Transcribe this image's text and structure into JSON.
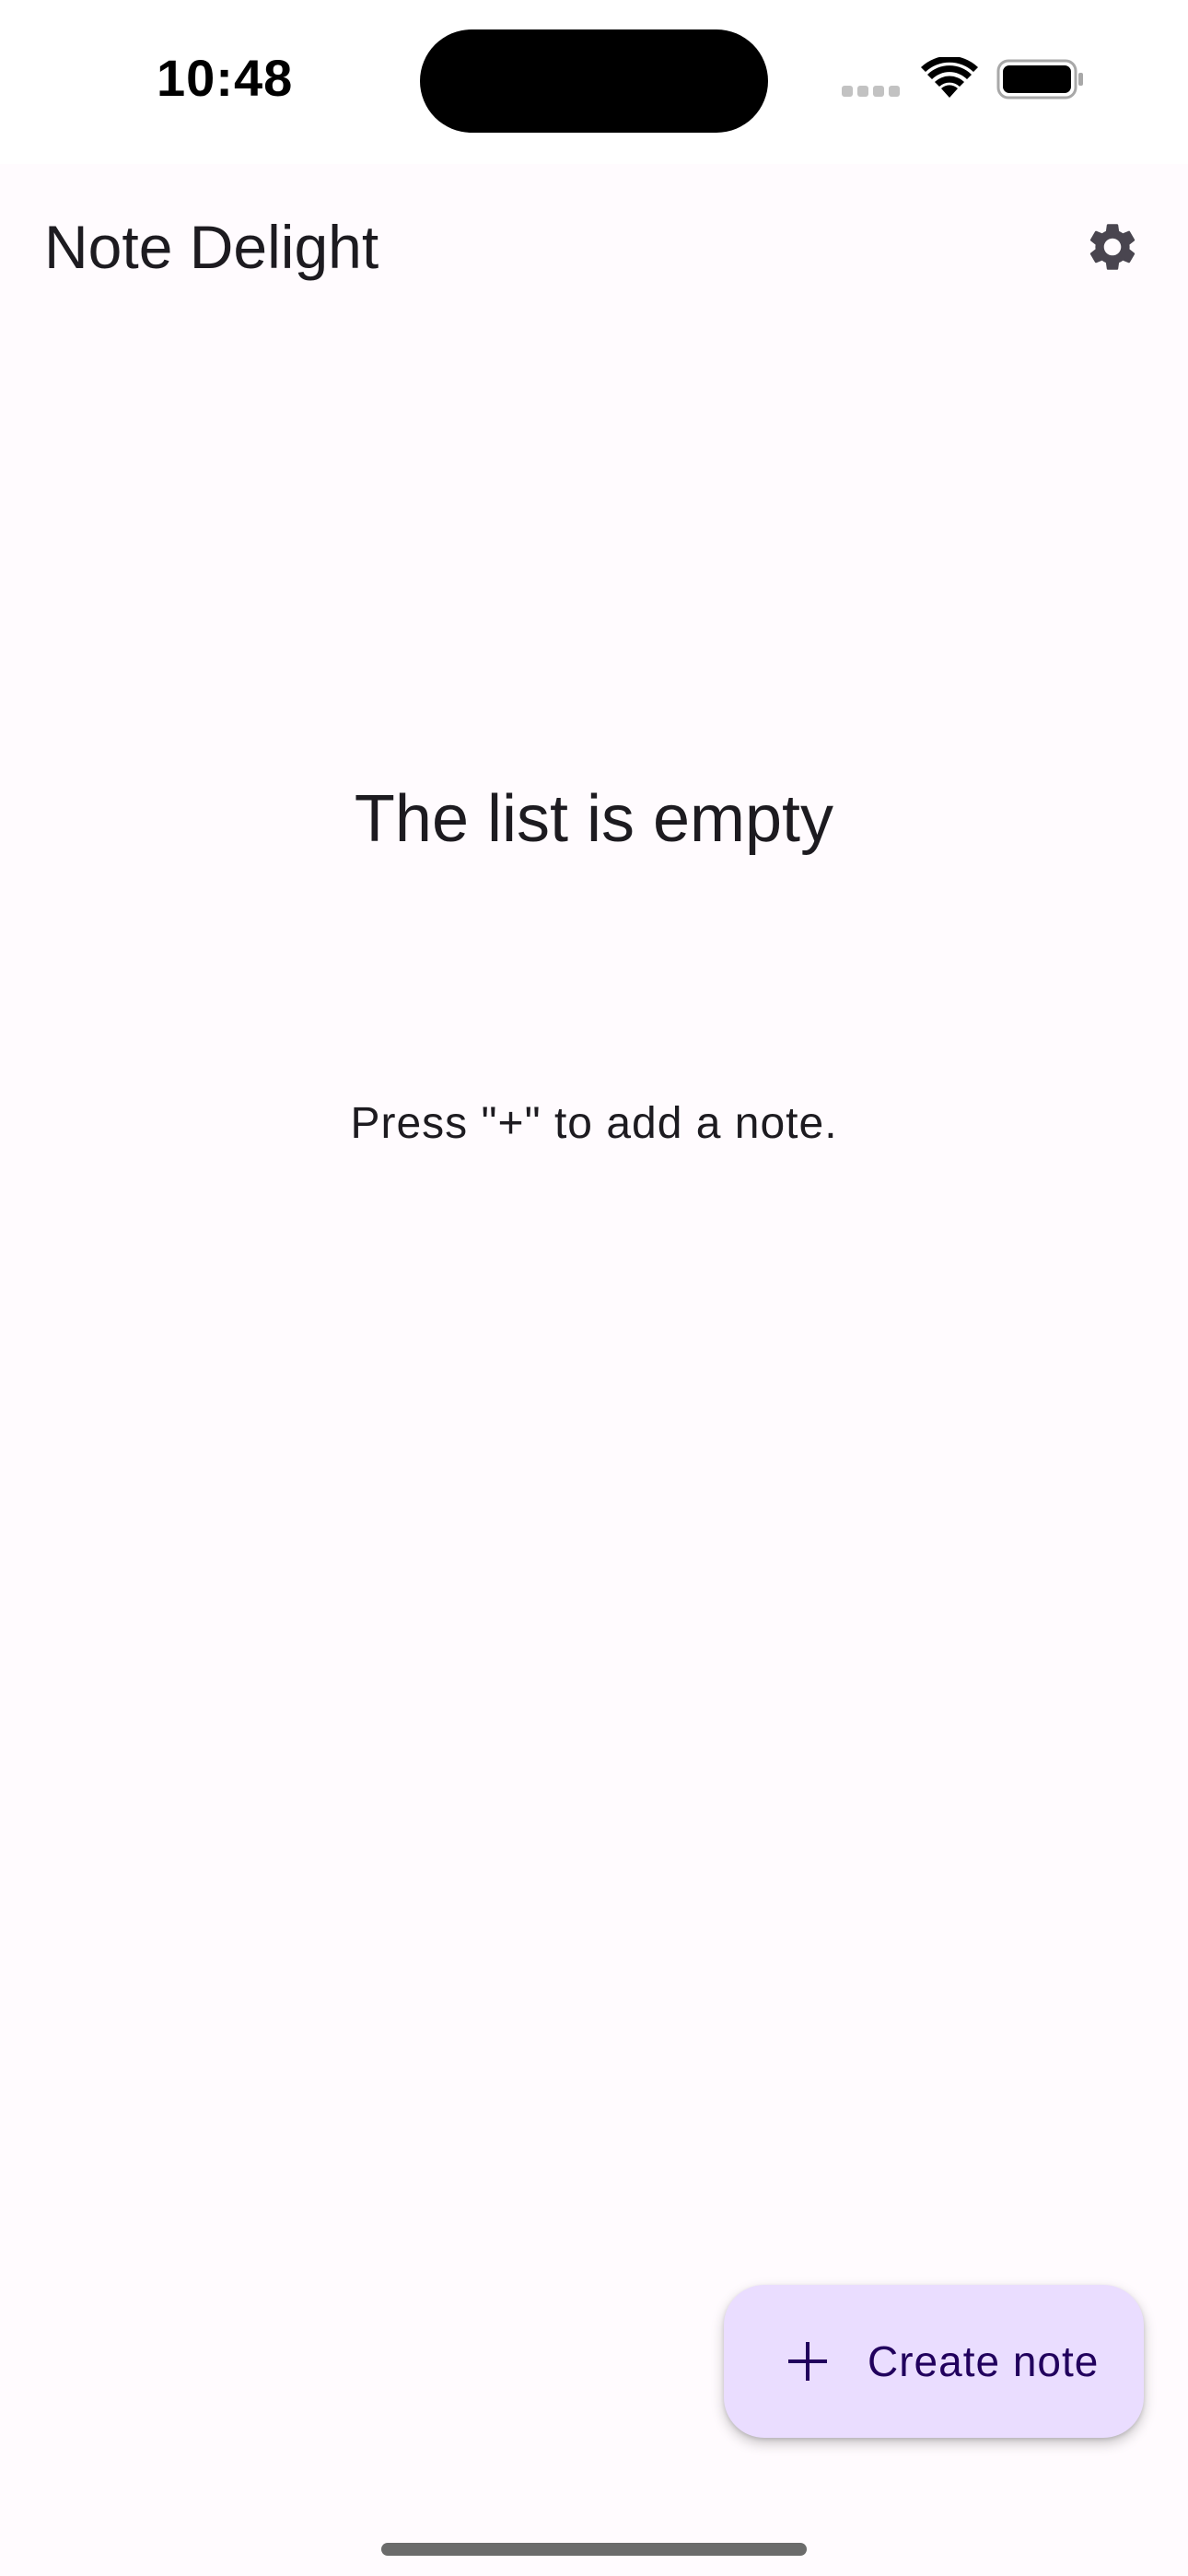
{
  "status_bar": {
    "time": "10:48",
    "icons": [
      "signal-icon",
      "wifi-icon",
      "battery-icon"
    ]
  },
  "app_bar": {
    "title": "Note Delight",
    "settings_icon": "gear-icon"
  },
  "empty_state": {
    "title": "The list is empty",
    "subtitle": "Press \"+\" to add a note."
  },
  "fab": {
    "icon": "plus-icon",
    "label": "Create note"
  },
  "colors": {
    "background": "#fffbfe",
    "status_bar_background": "#ffffff",
    "text_primary": "#1d1b20",
    "fab_background": "#eaddff",
    "fab_foreground": "#21005d",
    "icon": "#49454f"
  }
}
